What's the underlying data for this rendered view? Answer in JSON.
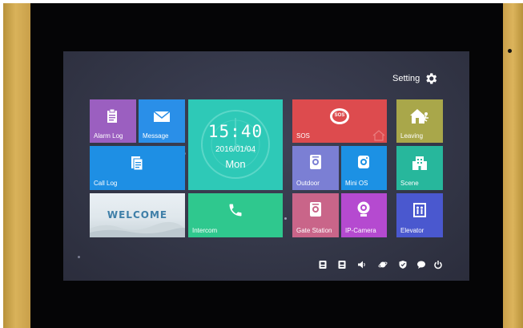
{
  "header": {
    "setting_label": "Setting"
  },
  "tiles": {
    "alarm_log": "Alarm Log",
    "message": "Message",
    "call_log": "Call Log",
    "welcome": "WELCOME",
    "intercom": "Intercom",
    "sos_title": "SOS",
    "sos_badge": "SOS",
    "outdoor": "Outdoor",
    "mini_os": "Mini OS",
    "gate_station": "Gate Station",
    "ip_camera": "IP-Camera",
    "leaving": "Leaving",
    "scene": "Scene",
    "elevator": "Elevator"
  },
  "clock": {
    "time": "15:40",
    "date": "2016/01/04",
    "day": "Mon"
  },
  "status_icons": [
    "phone-card-icon",
    "phone-card-icon",
    "volume-icon",
    "planet-icon",
    "shield-icon",
    "chat-icon",
    "power-icon"
  ],
  "colors": {
    "alarm_log": "#9b5fc0",
    "message": "#2a8fe8",
    "call_log": "#1e8fe4",
    "clock": "#2ec9b7",
    "intercom": "#2fc88e",
    "sos": "#dd4b4e",
    "outdoor": "#7b7fd4",
    "mini_os": "#1c91e4",
    "gate_station": "#c96589",
    "ip_camera": "#b54ad0",
    "leaving": "#a9a74a",
    "scene": "#27b79c",
    "elevator": "#4a58cf"
  }
}
